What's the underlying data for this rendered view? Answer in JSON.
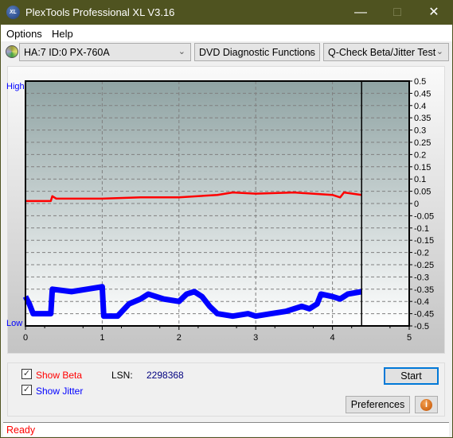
{
  "window": {
    "title": "PlexTools Professional XL V3.16",
    "logo": "XL"
  },
  "menu": [
    {
      "label": "Options"
    },
    {
      "label": "Help"
    }
  ],
  "toolbar": {
    "drive": "HA:7 ID:0  PX-760A",
    "function": "DVD Diagnostic Functions",
    "test": "Q-Check Beta/Jitter Test"
  },
  "chart_data": {
    "type": "line",
    "left_labels": {
      "high": "High",
      "low": "Low"
    },
    "xlim": [
      0,
      5
    ],
    "ylim": [
      -0.5,
      0.5
    ],
    "x_ticks": [
      "0",
      "1",
      "2",
      "3",
      "4",
      "5"
    ],
    "y_ticks": [
      "0.5",
      "0.45",
      "0.4",
      "0.35",
      "0.3",
      "0.25",
      "0.2",
      "0.15",
      "0.1",
      "0.05",
      "0",
      "-0.05",
      "-0.1",
      "-0.15",
      "-0.2",
      "-0.25",
      "-0.3",
      "-0.35",
      "-0.4",
      "-0.45",
      "-0.5"
    ],
    "grid": true,
    "marker_x": 4.38,
    "series": [
      {
        "key": "beta",
        "color": "#ff0000",
        "x": [
          0,
          0.3,
          0.33,
          0.35,
          0.4,
          0.6,
          1.0,
          1.5,
          2.0,
          2.5,
          2.7,
          3.0,
          3.5,
          4.0,
          4.1,
          4.15,
          4.38
        ],
        "y": [
          0.01,
          0.01,
          0.01,
          0.03,
          0.02,
          0.02,
          0.02,
          0.025,
          0.025,
          0.035,
          0.045,
          0.04,
          0.045,
          0.035,
          0.025,
          0.045,
          0.035
        ]
      },
      {
        "key": "jitter",
        "color": "#0000ff",
        "x": [
          0,
          0.05,
          0.1,
          0.33,
          0.35,
          0.6,
          0.8,
          1.0,
          1.02,
          1.2,
          1.35,
          1.5,
          1.6,
          1.8,
          2.0,
          2.1,
          2.2,
          2.3,
          2.4,
          2.5,
          2.7,
          2.9,
          3.0,
          3.2,
          3.4,
          3.6,
          3.7,
          3.8,
          3.85,
          4.0,
          4.1,
          4.2,
          4.38
        ],
        "y": [
          -0.38,
          -0.41,
          -0.45,
          -0.45,
          -0.35,
          -0.36,
          -0.35,
          -0.34,
          -0.46,
          -0.46,
          -0.41,
          -0.39,
          -0.37,
          -0.39,
          -0.4,
          -0.37,
          -0.36,
          -0.38,
          -0.42,
          -0.45,
          -0.46,
          -0.45,
          -0.46,
          -0.45,
          -0.44,
          -0.42,
          -0.43,
          -0.41,
          -0.37,
          -0.38,
          -0.39,
          -0.37,
          -0.36
        ]
      }
    ]
  },
  "options": {
    "show_beta": "Show Beta",
    "show_jitter": "Show Jitter",
    "beta_checked": true,
    "jitter_checked": true,
    "lsn_label": "LSN:",
    "lsn_value": "2298368"
  },
  "buttons": {
    "start": "Start",
    "preferences": "Preferences",
    "info_icon": "info-icon"
  },
  "status": "Ready"
}
